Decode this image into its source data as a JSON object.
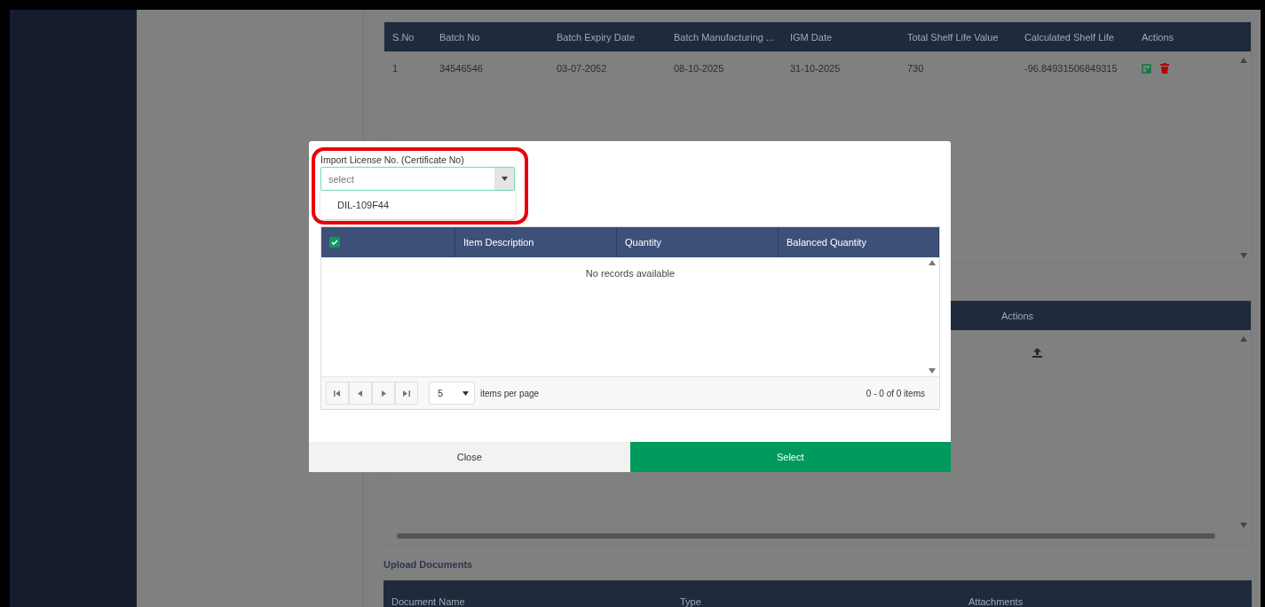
{
  "batch_table": {
    "columns": [
      "S.No",
      "Batch No",
      "Batch Expiry Date",
      "Batch Manufacturing ...",
      "IGM Date",
      "Total Shelf Life Value",
      "Calculated Shelf Life",
      "Actions"
    ],
    "rows": [
      {
        "cells": [
          "1",
          "34546546",
          "03-07-2052",
          "08-10-2025",
          "31-10-2025",
          "730",
          "-96.84931506849315"
        ]
      }
    ]
  },
  "second_table": {
    "columns": [
      "Actions"
    ]
  },
  "upload_documents": {
    "title": "Upload Documents",
    "columns": [
      "Document Name",
      "Type",
      "Attachments"
    ]
  },
  "modal": {
    "field": {
      "label": "Import License No. (Certificate No)",
      "placeholder": "select",
      "expanded": true,
      "options": [
        {
          "label": "DIL-109F44"
        }
      ]
    },
    "grid": {
      "select_all_checked": true,
      "columns": [
        "Item Description",
        "Quantity",
        "Balanced Quantity"
      ],
      "empty_text": "No records available",
      "pager": {
        "page_size": "5",
        "page_size_label": "items per page",
        "summary": "0 - 0 of 0 items"
      }
    },
    "buttons": [
      {
        "label": "Close",
        "kind": "secondary"
      },
      {
        "label": "Select",
        "kind": "primary"
      }
    ]
  }
}
